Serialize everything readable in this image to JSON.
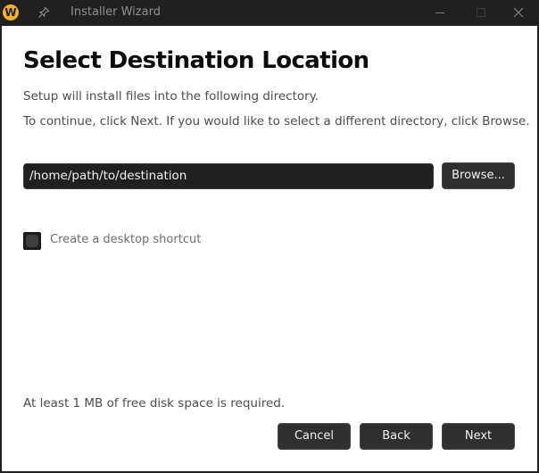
{
  "window": {
    "title": "Installer Wizard",
    "app_icon_letter": "W"
  },
  "page": {
    "heading": "Select Destination Location",
    "description_line1": "Setup will install files into the following directory.",
    "description_line2": "To continue, click Next. If you would like to select a different directory, click Browse."
  },
  "destination": {
    "path_value": "/home/path/to/destination",
    "browse_label": "Browse..."
  },
  "options": {
    "desktop_shortcut_label": "Create a desktop shortcut",
    "desktop_shortcut_checked": false
  },
  "footer": {
    "space_note": "At least 1 MB of free disk space is required.",
    "cancel_label": "Cancel",
    "back_label": "Back",
    "next_label": "Next"
  },
  "colors": {
    "app_icon": "#f2b12a",
    "titlebar": "#202020",
    "button_bg": "#2f2f2f",
    "content_bg": "#ffffff"
  }
}
